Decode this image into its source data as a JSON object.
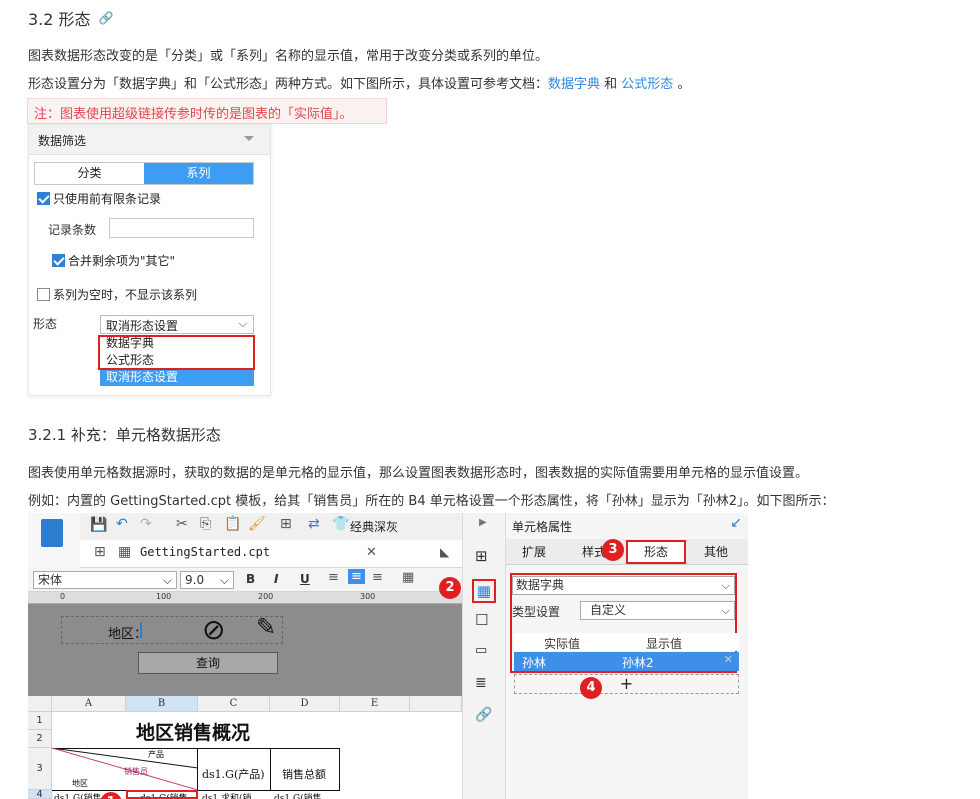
{
  "heading_32": "3.2 形态",
  "para1": "图表数据形态改变的是「分类」或「系列」名称的显示值，常用于改变分类或系列的单位。",
  "para2_prefix": "形态设置分为「数据字典」和「公式形态」两种方式。如下图所示，具体设置可参考文档：",
  "para2_link1": "数据字典",
  "para2_and": " 和 ",
  "para2_link2": "公式形态",
  "para2_suffix": " 。",
  "note": "注：图表使用超级链接传参时传的是图表的「实际值」。",
  "panel1": {
    "header": "数据筛选",
    "seg_left": "分类",
    "seg_right": "系列",
    "chk_limit": "只使用前有限条记录",
    "record_count_label": "记录条数",
    "chk_merge": "合并剩余项为\"其它\"",
    "chk_null": "系列为空时，不显示该系列",
    "form_label": "形态",
    "form_value": "取消形态设置",
    "options": [
      "数据字典",
      "公式形态",
      "取消形态设置"
    ]
  },
  "heading_321": "3.2.1 补充：单元格数据形态",
  "para3": "图表使用单元格数据源时，获取的数据的是单元格的显示值，那么设置图表数据形态时，图表数据的实际值需要用单元格的显示值设置。",
  "para4": "例如：内置的 GettingStarted.cpt 模板，给其「销售员」所在的 B4 单元格设置一个形态属性，将「孙林」显示为「孙林2」。如下图所示：",
  "designer": {
    "theme_label": "经典深灰",
    "file_name": "GettingStarted.cpt",
    "font_name": "宋体",
    "font_size": "9.0",
    "bold": "B",
    "italic": "I",
    "underline": "U",
    "ruler_ticks": [
      "0",
      "100",
      "200",
      "300"
    ],
    "region_label": "地区：",
    "query_button": "查询",
    "columns": [
      "A",
      "B",
      "C",
      "D",
      "E"
    ],
    "rows": [
      "1",
      "2",
      "3",
      "4"
    ],
    "report_title": "地区销售概况",
    "slash_product": "产品",
    "slash_seller": "销售员",
    "slash_region": "地区",
    "cell_c3": "ds1.G(产品)",
    "cell_d3": "销售总额",
    "cell_row4": [
      "ds1.G(销售",
      "ds1.G(销售",
      "ds1.求和(销",
      "ds1.G(销售"
    ],
    "right_panel_title": "单元格属性",
    "tabs": [
      "扩展",
      "样式",
      "形态",
      "其他"
    ],
    "dict_type": "数据字典",
    "type_setting_label": "类型设置",
    "type_setting_value": "自定义",
    "col_actual": "实际值",
    "col_display": "显示值",
    "row_actual": "孙林",
    "row_display": "孙林2",
    "add_symbol": "+",
    "badges": [
      "1",
      "2",
      "3",
      "4"
    ]
  },
  "colors": {
    "accent": "#3d9df3",
    "red": "#e02020",
    "link": "#2b8ae6"
  }
}
